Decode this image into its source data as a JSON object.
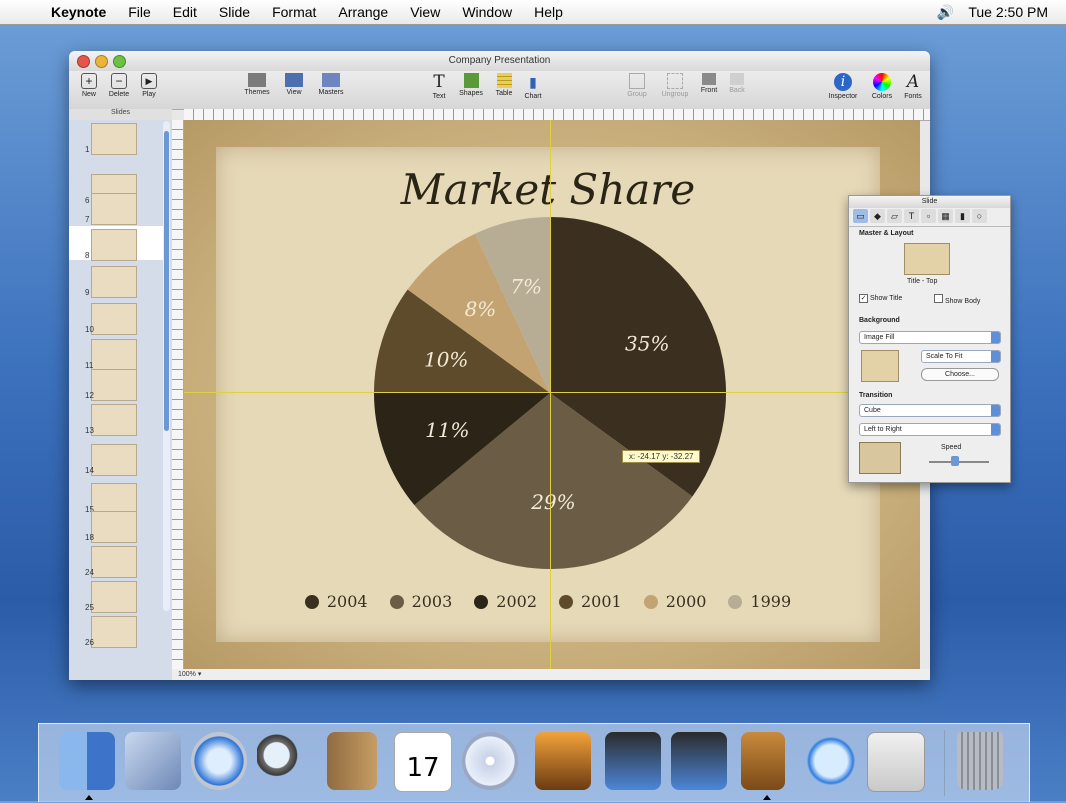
{
  "menubar": {
    "app": "Keynote",
    "items": [
      "File",
      "Edit",
      "Slide",
      "Format",
      "Arrange",
      "View",
      "Window",
      "Help"
    ],
    "clock": "Tue 2:50 PM",
    "volume_icon": "speaker-icon"
  },
  "window": {
    "title": "Company Presentation",
    "toolbar": {
      "new": "New",
      "delete": "Delete",
      "play": "Play",
      "themes": "Themes",
      "view": "View",
      "masters": "Masters",
      "text": "Text",
      "shapes": "Shapes",
      "table": "Table",
      "chart": "Chart",
      "group": "Group",
      "ungroup": "Ungroup",
      "front": "Front",
      "back": "Back",
      "inspector": "Inspector",
      "colors": "Colors",
      "fonts": "Fonts"
    },
    "sidebar_title": "Slides",
    "slide_numbers": [
      "1",
      "6",
      "7",
      "8",
      "9",
      "10",
      "11",
      "12",
      "13",
      "14",
      "15",
      "18",
      "24",
      "25",
      "26"
    ],
    "zoom": "100%"
  },
  "slide": {
    "title": "Market Share",
    "coord_readout": "x: -24.17  y: -32.27"
  },
  "chart_data": {
    "type": "pie",
    "title": "Market Share",
    "labels": [
      "2004",
      "2003",
      "2002",
      "2001",
      "2000",
      "1999"
    ],
    "values": [
      35,
      29,
      11,
      10,
      8,
      7
    ],
    "value_labels": [
      "35%",
      "29%",
      "11%",
      "10%",
      "8%",
      "7%"
    ],
    "colors": [
      "#3b3020",
      "#6b5d45",
      "#2c2416",
      "#5e4b2c",
      "#c4a372",
      "#b7ad94"
    ],
    "legend": "bottom"
  },
  "inspector": {
    "title": "Slide",
    "master_section": "Master & Layout",
    "master_name": "Title - Top",
    "show_title": "Show Title",
    "show_body": "Show Body",
    "background_section": "Background",
    "background_fill": "Image Fill",
    "scale": "Scale To Fit",
    "choose": "Choose...",
    "transition_section": "Transition",
    "transition": "Cube",
    "direction": "Left to Right",
    "speed": "Speed"
  },
  "dock": {
    "apps": [
      "Finder",
      "Mail",
      "Safari",
      "Sherlock",
      "Address Book",
      "iCal",
      "iTunes",
      "iPhoto",
      "iMovie",
      "iDVD",
      "Keynote",
      "QuickTime",
      "System Preferences",
      "Trash"
    ],
    "ical_date": "17"
  }
}
